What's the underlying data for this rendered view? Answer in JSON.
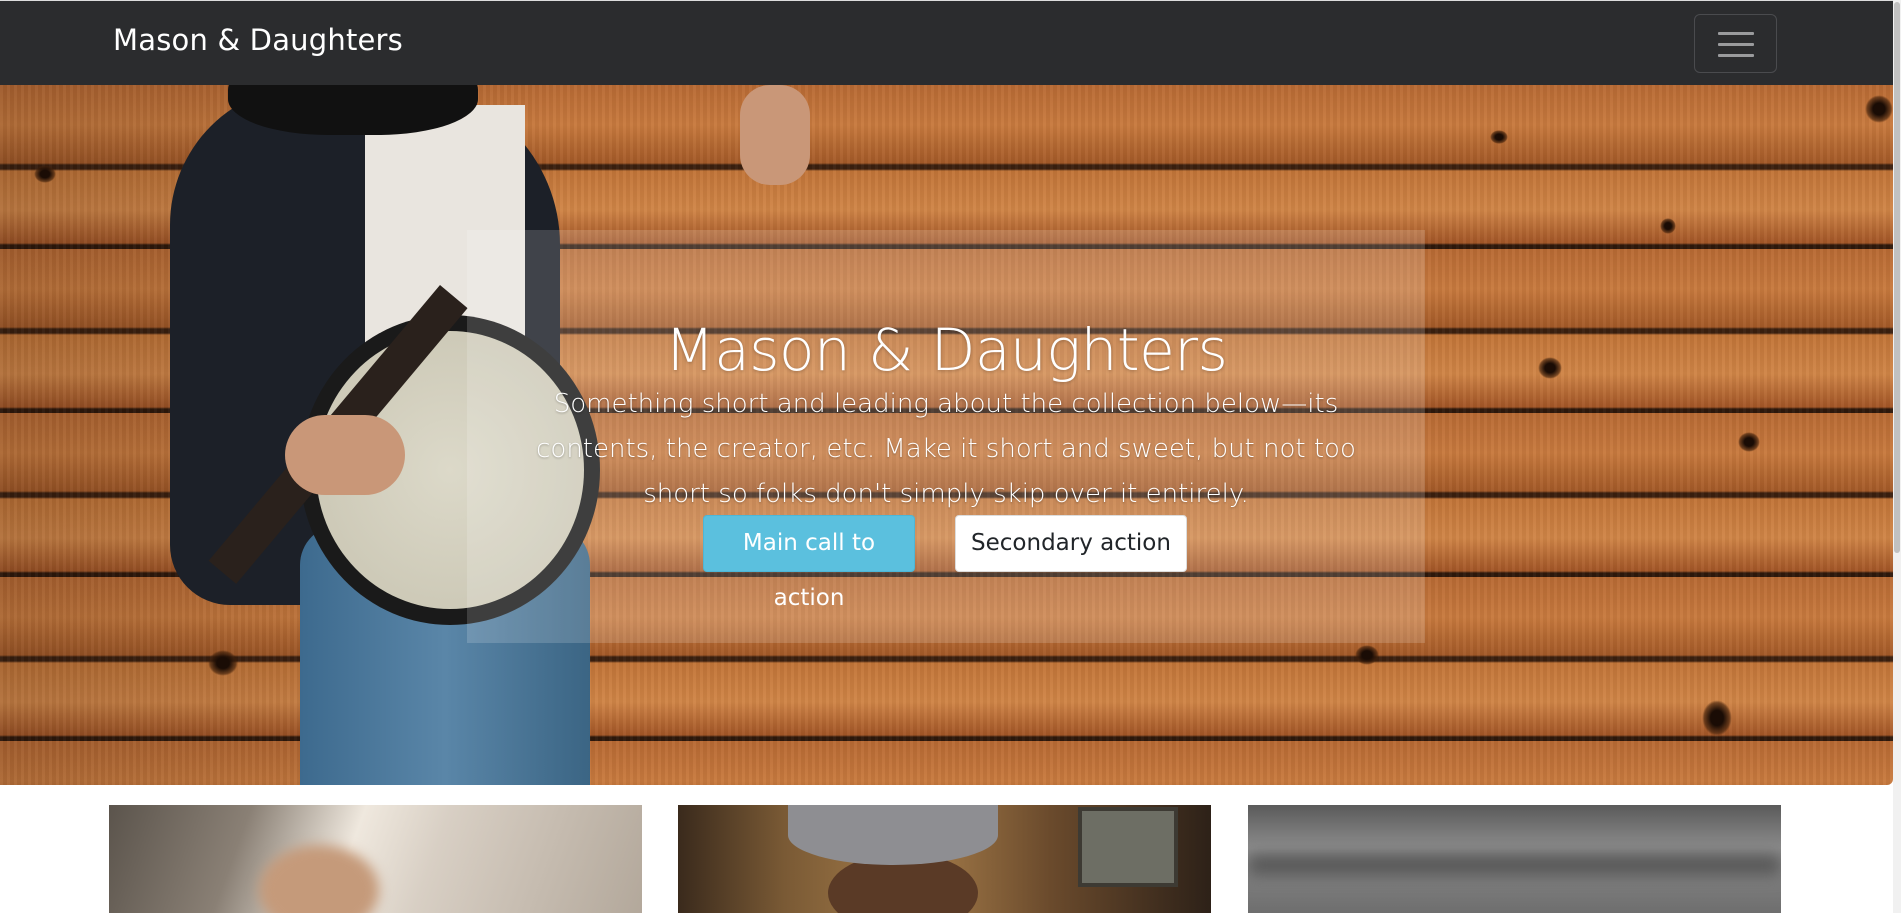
{
  "navbar": {
    "brand": "Mason & Daughters",
    "toggle_label": "Toggle navigation"
  },
  "hero": {
    "title": "Mason & Daughters",
    "lead": "Something short and leading about the collection below—its contents, the creator, etc. Make it short and sweet, but not too short so folks don't simply skip over it entirely.",
    "primary_button": "Main call to action",
    "secondary_button": "Secondary action"
  },
  "colors": {
    "navbar_bg": "#2b2c2e",
    "primary": "#5bc0de",
    "secondary_bg": "#ffffff"
  },
  "icons": {
    "toggler": "hamburger-icon"
  },
  "cards": [
    {
      "image": "guitarist-photo"
    },
    {
      "image": "woman-in-hat-photo"
    },
    {
      "image": "grayscale-photo"
    }
  ]
}
